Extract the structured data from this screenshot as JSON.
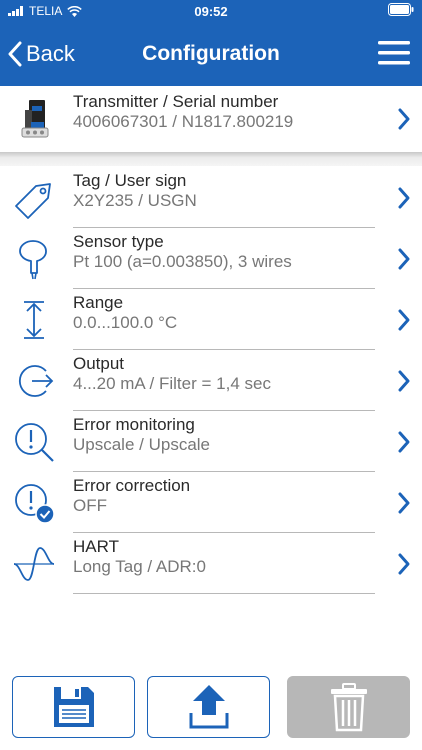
{
  "status_bar": {
    "carrier": "TELIA",
    "time": "09:52"
  },
  "nav": {
    "back_label": "Back",
    "title": "Configuration"
  },
  "transmitter": {
    "title": "Transmitter / Serial number",
    "value": "4006067301 / N1817.800219"
  },
  "items": [
    {
      "title": "Tag / User sign",
      "value": "X2Y235 / USGN",
      "icon": "tag-icon"
    },
    {
      "title": "Sensor type",
      "value": "Pt 100 (a=0.003850), 3 wires",
      "icon": "sensor-probe-icon"
    },
    {
      "title": "Range",
      "value": "0.0...100.0 °C",
      "icon": "range-arrows-icon"
    },
    {
      "title": "Output",
      "value": "4...20 mA / Filter = 1,4 sec",
      "icon": "output-icon"
    },
    {
      "title": "Error monitoring",
      "value": "Upscale / Upscale",
      "icon": "error-monitor-icon"
    },
    {
      "title": "Error correction",
      "value": "OFF",
      "icon": "error-correction-icon"
    },
    {
      "title": "HART",
      "value": "Long Tag / ADR:0",
      "icon": "sine-wave-icon"
    }
  ],
  "colors": {
    "primary": "#1c63b8",
    "disabled": "#b7b7b7"
  },
  "bottom_buttons": [
    {
      "name": "save",
      "icon": "floppy-disk-icon",
      "enabled": true
    },
    {
      "name": "upload",
      "icon": "upload-icon",
      "enabled": true
    },
    {
      "name": "delete",
      "icon": "trash-icon",
      "enabled": false
    }
  ]
}
